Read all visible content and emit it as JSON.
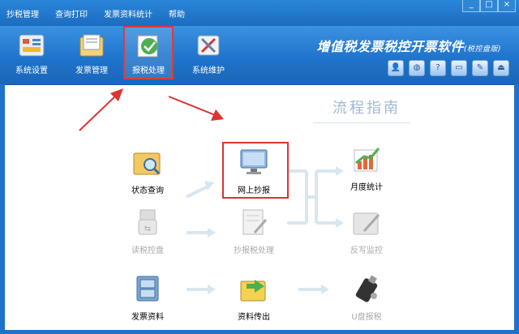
{
  "menu": [
    "抄税管理",
    "查询打印",
    "发票资料统计",
    "帮助"
  ],
  "window_buttons": [
    "_",
    "□",
    "×"
  ],
  "toolbar": [
    {
      "label": "系统设置",
      "icon": "settings-icon"
    },
    {
      "label": "发票管理",
      "icon": "invoice-folder-icon"
    },
    {
      "label": "报税处理",
      "icon": "tax-process-icon",
      "selected": true
    },
    {
      "label": "系统维护",
      "icon": "maintenance-icon"
    }
  ],
  "brand": {
    "title": "增值税发票税控开票软件",
    "sub": "(税控盘版)"
  },
  "toolbar_icons": [
    "user-icon",
    "globe-icon",
    "help-icon",
    "window-icon",
    "tool-icon",
    "exit-icon"
  ],
  "guide_title": "流程指南",
  "flow": {
    "status_query": "状态查询",
    "read_disk": "读税控盘",
    "invoice_data": "发票资料",
    "online_report": "网上抄报",
    "report_process": "抄报税处理",
    "data_transfer": "资料传出",
    "monthly_stats": "月度统计",
    "write_monitor": "反写监控",
    "usb_report": "U盘报税"
  },
  "colors": {
    "accent": "#1e73c8",
    "highlight": "#e03a3a",
    "arrow": "#d8e6ef"
  }
}
